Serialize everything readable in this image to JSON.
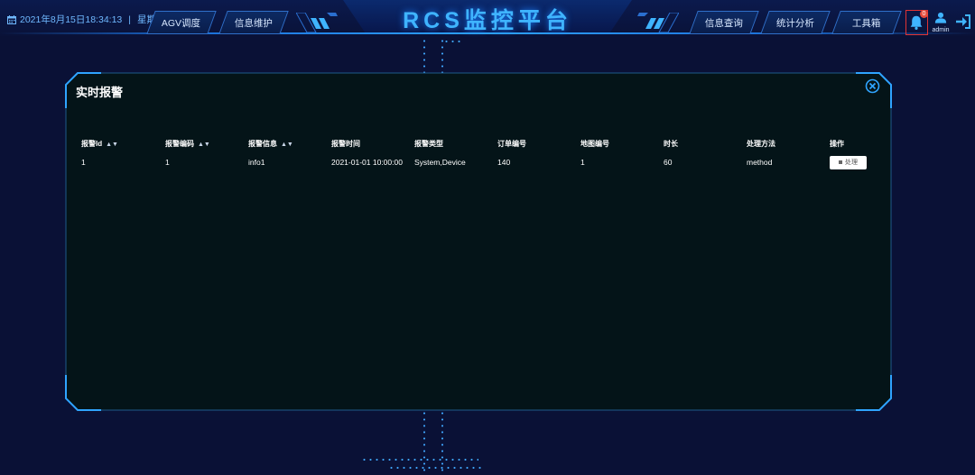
{
  "header": {
    "datetime": "2021年8月15日18:34:13",
    "weekday": "星期日",
    "title": "RCS监控平台",
    "left_nav": [
      "AGV调度",
      "信息维护"
    ],
    "right_nav": [
      "信息查询",
      "统计分析",
      "工具箱"
    ],
    "bell_icon": "bell-icon",
    "notification_badge": "0",
    "user": "admin",
    "logout_icon": "logout-icon",
    "colors": {
      "accent": "#3fb4ff",
      "background": "#0a1136",
      "alert": "#e23333"
    }
  },
  "modal": {
    "title": "实时报警",
    "close_icon": "close-circle-icon",
    "columns": [
      "报警Id",
      "报警编码",
      "报警信息",
      "报警时间",
      "报警类型",
      "订单编号",
      "地图编号",
      "时长",
      "处理方法",
      "操作"
    ],
    "rows": [
      {
        "cells": [
          "1",
          "1",
          "info1",
          "2021-01-01 10:00:00",
          "System,Device",
          "140",
          "1",
          "60",
          "method"
        ],
        "action_label": "处理"
      }
    ]
  }
}
